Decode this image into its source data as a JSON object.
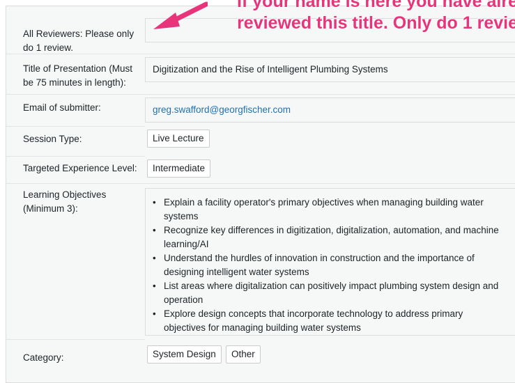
{
  "annotation": {
    "line1": "If your name is here you have alre",
    "line2": "reviewed this title. Only do 1 revie",
    "color": "#e8347a"
  },
  "fields": {
    "reviewers": {
      "label_l1": "All Reviewers: Please only",
      "label_l2": "do 1 review.",
      "value": ""
    },
    "title": {
      "label_l1": "Title of Presentation (Must",
      "label_l2": "be 75 minutes in length):",
      "value": "Digitization and the Rise of Intelligent Plumbing Systems"
    },
    "email": {
      "label": "Email of submitter:",
      "value": "greg.swafford@georgfischer.com"
    },
    "session_type": {
      "label": "Session Type:",
      "tag": "Live Lecture"
    },
    "experience": {
      "label": "Targeted Experience Level:",
      "tag": "Intermediate"
    },
    "objectives": {
      "label_l1": "Learning Objectives",
      "label_l2": "(Minimum 3):",
      "items": [
        {
          "l1": "Explain a facility operator's primary objectives when managing building water",
          "l2": "systems"
        },
        {
          "l1": "Recognize key differences in digitization, digitalization, automation, and machine",
          "l2": "learning/AI"
        },
        {
          "l1": "Understand the hurdles of innovation in construction and the importance of",
          "l2": "designing intelligent water systems"
        },
        {
          "l1": "List areas where digitalization can positively impact plumbing system design and",
          "l2": "operation"
        },
        {
          "l1": "Explore design concepts that incorporate technology to address primary",
          "l2": "objectives for managing building water systems"
        }
      ]
    },
    "category": {
      "label": "Category:",
      "tags": [
        "System Design",
        "Other"
      ]
    }
  }
}
